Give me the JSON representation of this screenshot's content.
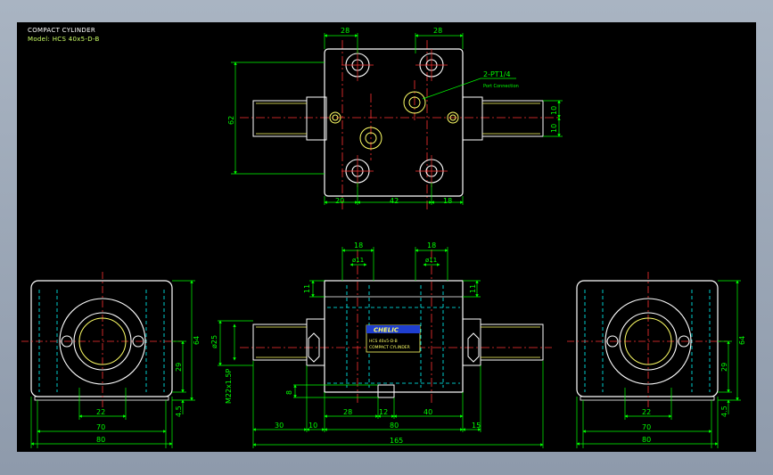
{
  "title": "COMPACT CYLINDER",
  "model": "Model: HCS 40x5-D-B",
  "port_label": "2-PT1/4",
  "port_sub": "Port Connection",
  "brand": "CHELIC",
  "plate_line1": "HCS 40x5-D-B",
  "plate_line2": "COMPACT CYLINDER",
  "colors": {
    "bg": "#000000",
    "part": "#ffffff",
    "dim": "#00ff00",
    "center": "#ff3333",
    "hidden": "#00ffff",
    "thread": "#ffff66",
    "plate": "#1f3fd0"
  },
  "dims": {
    "top_28a": "28",
    "top_28b": "28",
    "top_62": "62",
    "top_10a": "10",
    "top_10b": "10",
    "top_20": "20",
    "top_42": "42",
    "top_18": "18",
    "mid_18a": "18",
    "mid_18b": "18",
    "mid_d11a": "ø11",
    "mid_d11b": "ø11",
    "mid_11a": "11",
    "mid_11b": "11",
    "mid_d25": "ø25",
    "mid_m22": "M22x1.5P",
    "mid_8": "8",
    "mid_28": "28",
    "mid_12": "12",
    "mid_40": "40",
    "mid_30": "30",
    "mid_10": "10",
    "mid_80": "80",
    "mid_15": "15",
    "mid_165": "165",
    "l_64": "64",
    "l_29": "29",
    "l_45": "4.5",
    "l_22": "22",
    "l_70": "70",
    "l_80": "80",
    "r_64": "64",
    "r_29": "29",
    "r_45": "4.5",
    "r_22": "22",
    "r_70": "70",
    "r_80": "80"
  }
}
